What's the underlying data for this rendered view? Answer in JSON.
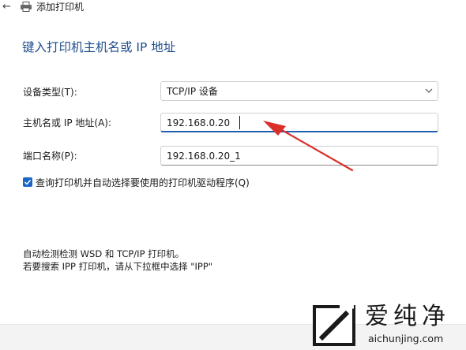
{
  "window": {
    "title": "添加打印机",
    "back_icon": "back-arrow-icon",
    "printer_icon": "printer-icon"
  },
  "heading": "键入打印机主机名或 IP 地址",
  "form": {
    "device_type": {
      "label": "设备类型(T):",
      "value": "TCP/IP 设备"
    },
    "host": {
      "label": "主机名或 IP 地址(A):",
      "value": "192.168.0.20"
    },
    "port": {
      "label": "端口名称(P):",
      "value": "192.168.0.20_1"
    },
    "query_checkbox": {
      "label": "查询打印机并自动选择要使用的打印机驱动程序(Q)",
      "checked": true
    }
  },
  "info": {
    "line1": "自动检测检测 WSD 和 TCP/IP 打印机。",
    "line2": "若要搜索 IPP 打印机，请从下拉框中选择 \"IPP\""
  },
  "watermark": {
    "name": "爱纯净",
    "url": "aichunjing.com"
  },
  "colors": {
    "heading": "#1f4e8c",
    "accent": "#1a66c7",
    "annotation_arrow": "#d9302c"
  }
}
